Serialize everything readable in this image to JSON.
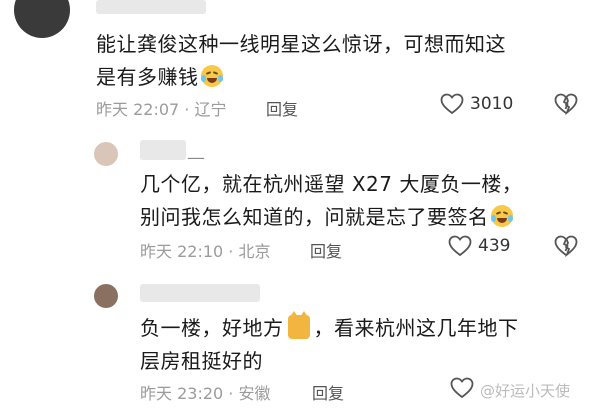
{
  "comments": [
    {
      "text_line1": "能让龚俊这种一线明星这么惊讶，可想而知这",
      "text_line2": "是有多赚钱",
      "emoji": "laughing-crying-emoji",
      "meta": "昨天 22:07 · 辽宁",
      "reply_label": "回复",
      "likes": "3010"
    },
    {
      "username_fragment": "__",
      "text_line1": "几个亿，就在杭州遥望 X27 大厦负一楼，",
      "text_line2": "别问我怎么知道的，问就是忘了要签名",
      "emoji": "laughing-crying-emoji",
      "meta": "昨天 22:10 · 北京",
      "reply_label": "回复",
      "likes": "439"
    },
    {
      "text_line1_a": "负一楼，好地方",
      "text_line1_b": "，看来杭州这几年地下",
      "text_line2": "层房租挺好的",
      "emoji": "cat-emoji",
      "meta": "昨天 23:20 · 安徽",
      "reply_label": "回复"
    }
  ],
  "watermark": "@好运小天使"
}
